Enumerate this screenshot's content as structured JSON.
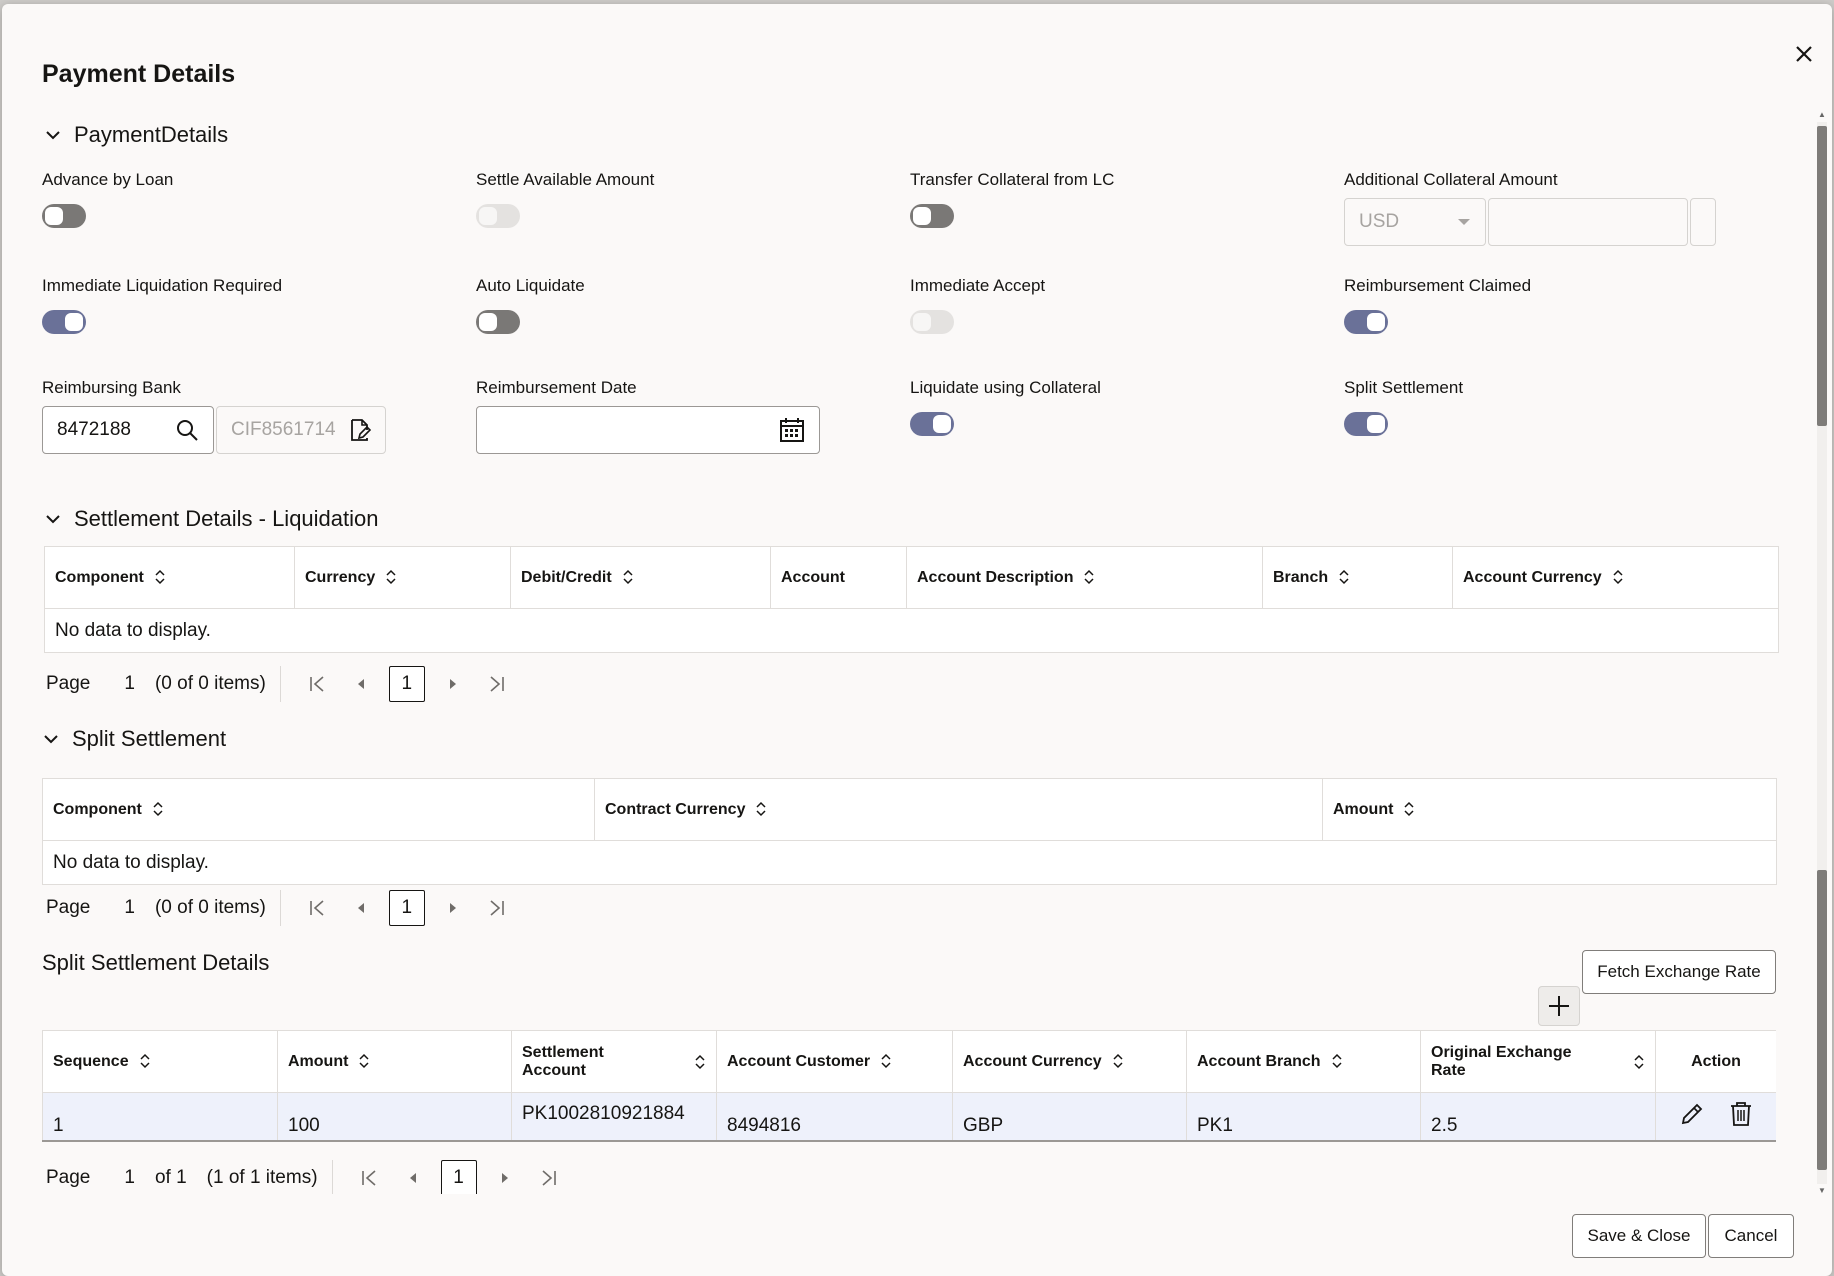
{
  "dialog": {
    "title": "Payment Details",
    "close_label": "×"
  },
  "payment": {
    "section_title": "PaymentDetails",
    "advance_by_loan": {
      "label": "Advance by Loan",
      "state": "off"
    },
    "settle_available_amount": {
      "label": "Settle Available Amount",
      "state": "disabled"
    },
    "transfer_collateral": {
      "label": "Transfer Collateral from LC",
      "state": "off"
    },
    "additional_collateral": {
      "label": "Additional Collateral Amount",
      "currency": "USD",
      "amount": ""
    },
    "immediate_liquidation": {
      "label": "Immediate Liquidation Required",
      "state": "on"
    },
    "auto_liquidate": {
      "label": "Auto Liquidate",
      "state": "off"
    },
    "immediate_accept": {
      "label": "Immediate Accept",
      "state": "disabled"
    },
    "reimbursement_claimed": {
      "label": "Reimbursement Claimed",
      "state": "on"
    },
    "reimbursing_bank": {
      "label": "Reimbursing Bank",
      "value": "8472188",
      "cif": "CIF8561714"
    },
    "reimbursement_date": {
      "label": "Reimbursement Date",
      "value": ""
    },
    "liquidate_collateral": {
      "label": "Liquidate using Collateral",
      "state": "on"
    },
    "split_settlement_toggle": {
      "label": "Split Settlement",
      "state": "on"
    }
  },
  "liquidation": {
    "section_title": "Settlement Details - Liquidation",
    "columns": [
      "Component",
      "Currency",
      "Debit/Credit",
      "Account",
      "Account Description",
      "Branch",
      "Account Currency"
    ],
    "empty_text": "No data to display.",
    "pager": {
      "label": "Page",
      "page": "1",
      "items": "(0 of 0 items)",
      "current": "1"
    }
  },
  "split": {
    "section_title": "Split Settlement",
    "columns": [
      "Component",
      "Contract Currency",
      "Amount"
    ],
    "empty_text": "No data to display.",
    "pager": {
      "label": "Page",
      "page": "1",
      "items": "(0 of 0 items)",
      "current": "1"
    }
  },
  "split_details": {
    "title": "Split Settlement Details",
    "fetch_button": "Fetch Exchange Rate",
    "columns": [
      "Sequence",
      "Amount",
      "Settlement Account",
      "Account Customer",
      "Account Currency",
      "Account Branch",
      "Original Exchange Rate",
      "Action"
    ],
    "rows": [
      {
        "sequence": "1",
        "amount": "100",
        "settlement_account": "PK1002810921884",
        "account_customer": "8494816",
        "account_currency": "GBP",
        "account_branch": "PK1",
        "exchange_rate": "2.5"
      }
    ],
    "pager": {
      "label": "Page",
      "page": "1",
      "of": "of 1",
      "items": "(1 of 1 items)",
      "current": "1"
    }
  },
  "footer": {
    "save_close": "Save & Close",
    "cancel": "Cancel"
  },
  "colors": {
    "toggle_on": "#6a7198",
    "toggle_off": "#7a7876",
    "row_highlight": "#eef1fb"
  }
}
